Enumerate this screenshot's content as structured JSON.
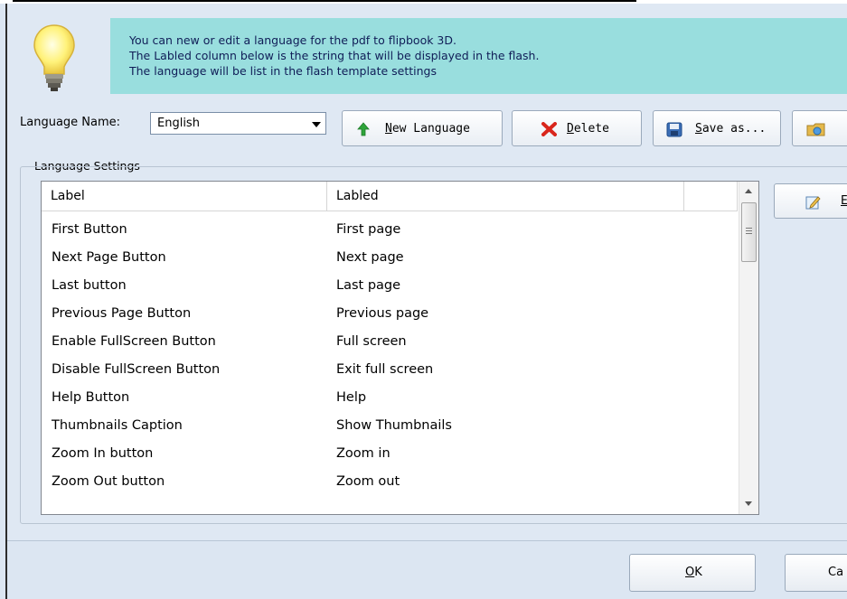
{
  "info": {
    "line1": "You can new or edit  a language for the pdf to flipbook 3D.",
    "line2": "The Labled column below is the string that will be displayed in the flash.",
    "line3": "The language will be list in the flash template settings"
  },
  "language": {
    "label": "Language Name:",
    "selected": "English"
  },
  "toolbar": {
    "new_accel": "N",
    "new_rest": "ew Language",
    "delete_accel": "D",
    "delete_rest": "elete",
    "saveas_accel": "S",
    "saveas_rest": "ave as..."
  },
  "settings": {
    "group_label": "Language Settings",
    "columns": [
      "Label",
      "Labled"
    ],
    "rows": [
      [
        "First Button",
        "First page"
      ],
      [
        "Next Page Button",
        "Next page"
      ],
      [
        "Last button",
        "Last page"
      ],
      [
        "Previous Page Button",
        "Previous page"
      ],
      [
        "Enable FullScreen Button",
        "Full screen"
      ],
      [
        "Disable FullScreen Button",
        "Exit full screen"
      ],
      [
        "Help Button",
        "Help"
      ],
      [
        "Thumbnails Caption",
        "Show Thumbnails"
      ],
      [
        "Zoom In button",
        "Zoom in"
      ],
      [
        "Zoom Out button",
        "Zoom out"
      ]
    ]
  },
  "side": {
    "edit_partial": "E"
  },
  "footer": {
    "ok_accel": "O",
    "ok_rest": "K",
    "cancel_partial": "Ca"
  },
  "icons": {
    "bulb": "lightbulb-icon",
    "new": "green-up-arrow-icon",
    "delete": "red-x-icon",
    "save": "floppy-disk-icon",
    "import": "folder-icon",
    "edit": "edit-pencil-icon"
  },
  "colors": {
    "banner": "#99dede",
    "banner_text": "#101d57",
    "window": "#dfe8f3"
  }
}
